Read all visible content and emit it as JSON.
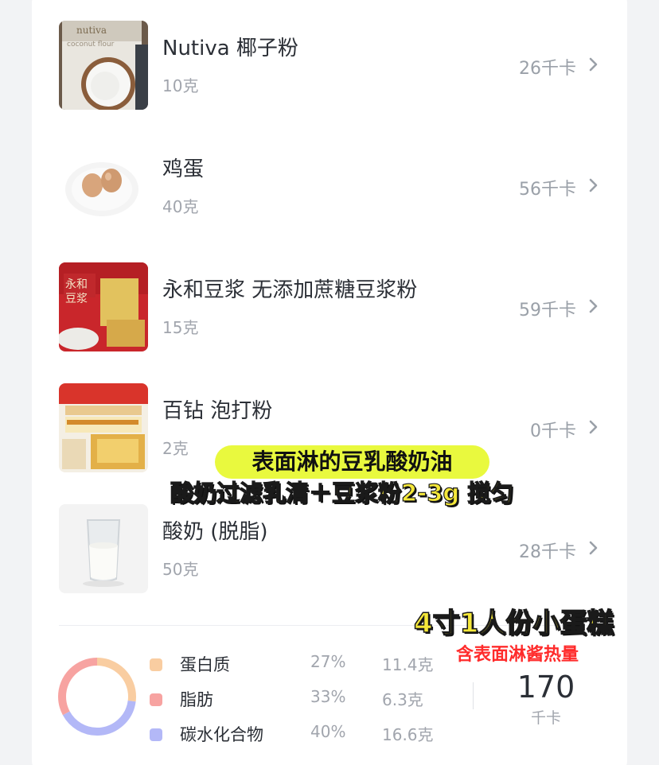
{
  "food_items": [
    {
      "name": "Nutiva 椰子粉",
      "amount": "10克",
      "calories": "26千卡",
      "image": "coconut-flour-bag"
    },
    {
      "name": "鸡蛋",
      "amount": "40克",
      "calories": "56千卡",
      "image": "eggs-plate"
    },
    {
      "name": "永和豆浆 无添加蔗糖豆浆粉",
      "amount": "15克",
      "calories": "59千卡",
      "image": "soy-milk-powder-bag"
    },
    {
      "name": "百钻 泡打粉",
      "amount": "2克",
      "calories": "0千卡",
      "image": "baking-powder-bag"
    },
    {
      "name": "酸奶 (脱脂)",
      "amount": "50克",
      "calories": "28千卡",
      "image": "yogurt-glass"
    }
  ],
  "nutrition": {
    "macros": [
      {
        "name": "蛋白质",
        "percent": "27%",
        "amount": "11.4克",
        "fraction": 0.27,
        "color": "#f9cda1"
      },
      {
        "name": "脂肪",
        "percent": "33%",
        "amount": "6.3克",
        "fraction": 0.33,
        "color": "#f7a3a1"
      },
      {
        "name": "碳水化合物",
        "percent": "40%",
        "amount": "16.6克",
        "fraction": 0.4,
        "color": "#b3b8f7"
      }
    ],
    "total_kcal": "170",
    "kcal_unit": "千卡"
  },
  "overlay": {
    "title": "表面淋的豆乳酸奶油",
    "subtitle": "酸奶过滤乳清＋豆浆粉2-3g  搅匀",
    "cake_note": "4寸1人份小蛋糕",
    "sauce_note": "含表面淋酱热量"
  },
  "colors": {
    "text_primary": "#2b2f36",
    "text_secondary": "#a1a5ad",
    "sticker_yellow": "#e9f93e",
    "sticker_red": "#ff2b2b"
  }
}
